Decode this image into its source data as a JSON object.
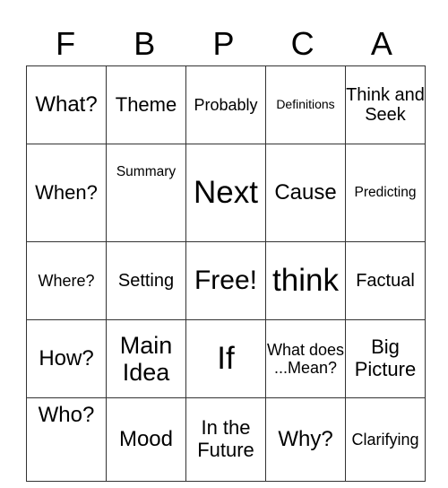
{
  "header": [
    "F",
    "B",
    "P",
    "C",
    "A"
  ],
  "grid": [
    [
      "What?",
      "Theme",
      "Probably",
      "Definitions",
      "Think and Seek"
    ],
    [
      "When?",
      "Summary",
      "Next",
      "Cause",
      "Predicting"
    ],
    [
      "Where?",
      "Setting",
      "Free!",
      "think",
      "Factual"
    ],
    [
      "How?",
      "Main Idea",
      "If",
      "What does ...Mean?",
      "Big Picture"
    ],
    [
      "Who?",
      "Mood",
      "In the Future",
      "Why?",
      "Clarifying"
    ]
  ]
}
